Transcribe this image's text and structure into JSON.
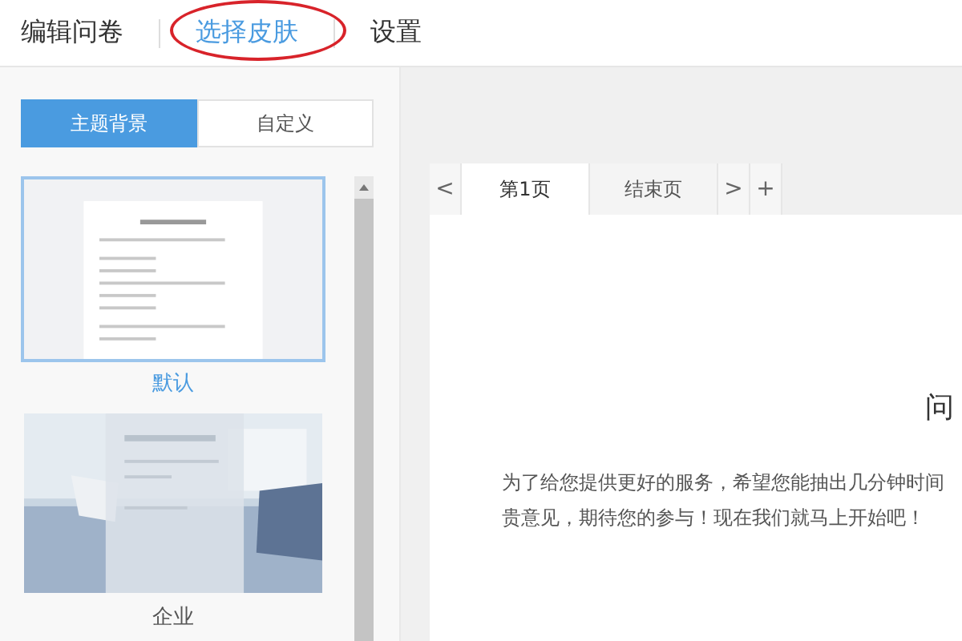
{
  "nav": [
    {
      "label": "编辑问卷",
      "selected": false,
      "circled": false
    },
    {
      "label": "选择皮肤",
      "selected": true,
      "circled": true
    },
    {
      "label": "设置",
      "selected": false,
      "circled": false
    }
  ],
  "skin_tabs": [
    {
      "label": "主题背景",
      "selected": true
    },
    {
      "label": "自定义",
      "selected": false
    }
  ],
  "skins": [
    {
      "label": "默认",
      "selected": true,
      "kind": "document"
    },
    {
      "label": "企业",
      "selected": false
    }
  ],
  "page_tabs": {
    "prev": "<",
    "next": ">",
    "add": "+",
    "tabs": [
      {
        "label": "第1页",
        "selected": true
      },
      {
        "label": "结束页",
        "selected": false
      }
    ]
  },
  "survey": {
    "title": "问",
    "intro_lines": [
      "为了给您提供更好的服务，希望您能抽出几分钟时间",
      "贵意见，期待您的参与！现在我们就马上开始吧！"
    ]
  }
}
